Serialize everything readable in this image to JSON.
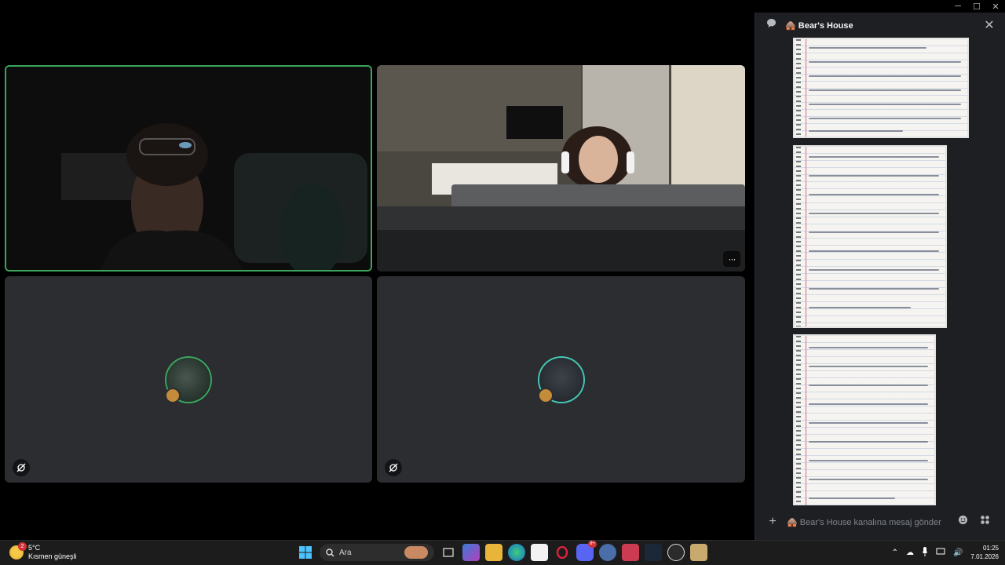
{
  "window_controls": {
    "minimize": "─",
    "maximize": "☐",
    "close": "✕"
  },
  "chat": {
    "title": "🛖 Bear's House",
    "input_placeholder": "🛖 Bear's House kanalına mesaj gönder",
    "add_label": "+",
    "close_label": "✕"
  },
  "tiles": {
    "more_label": "···"
  },
  "taskbar": {
    "weather_temp": "5°C",
    "weather_desc": "Kısmen güneşli",
    "weather_badge": "2",
    "search_placeholder": "Ara",
    "discord_badge": "9+",
    "time": "01:25",
    "date": "7.01.2026"
  }
}
